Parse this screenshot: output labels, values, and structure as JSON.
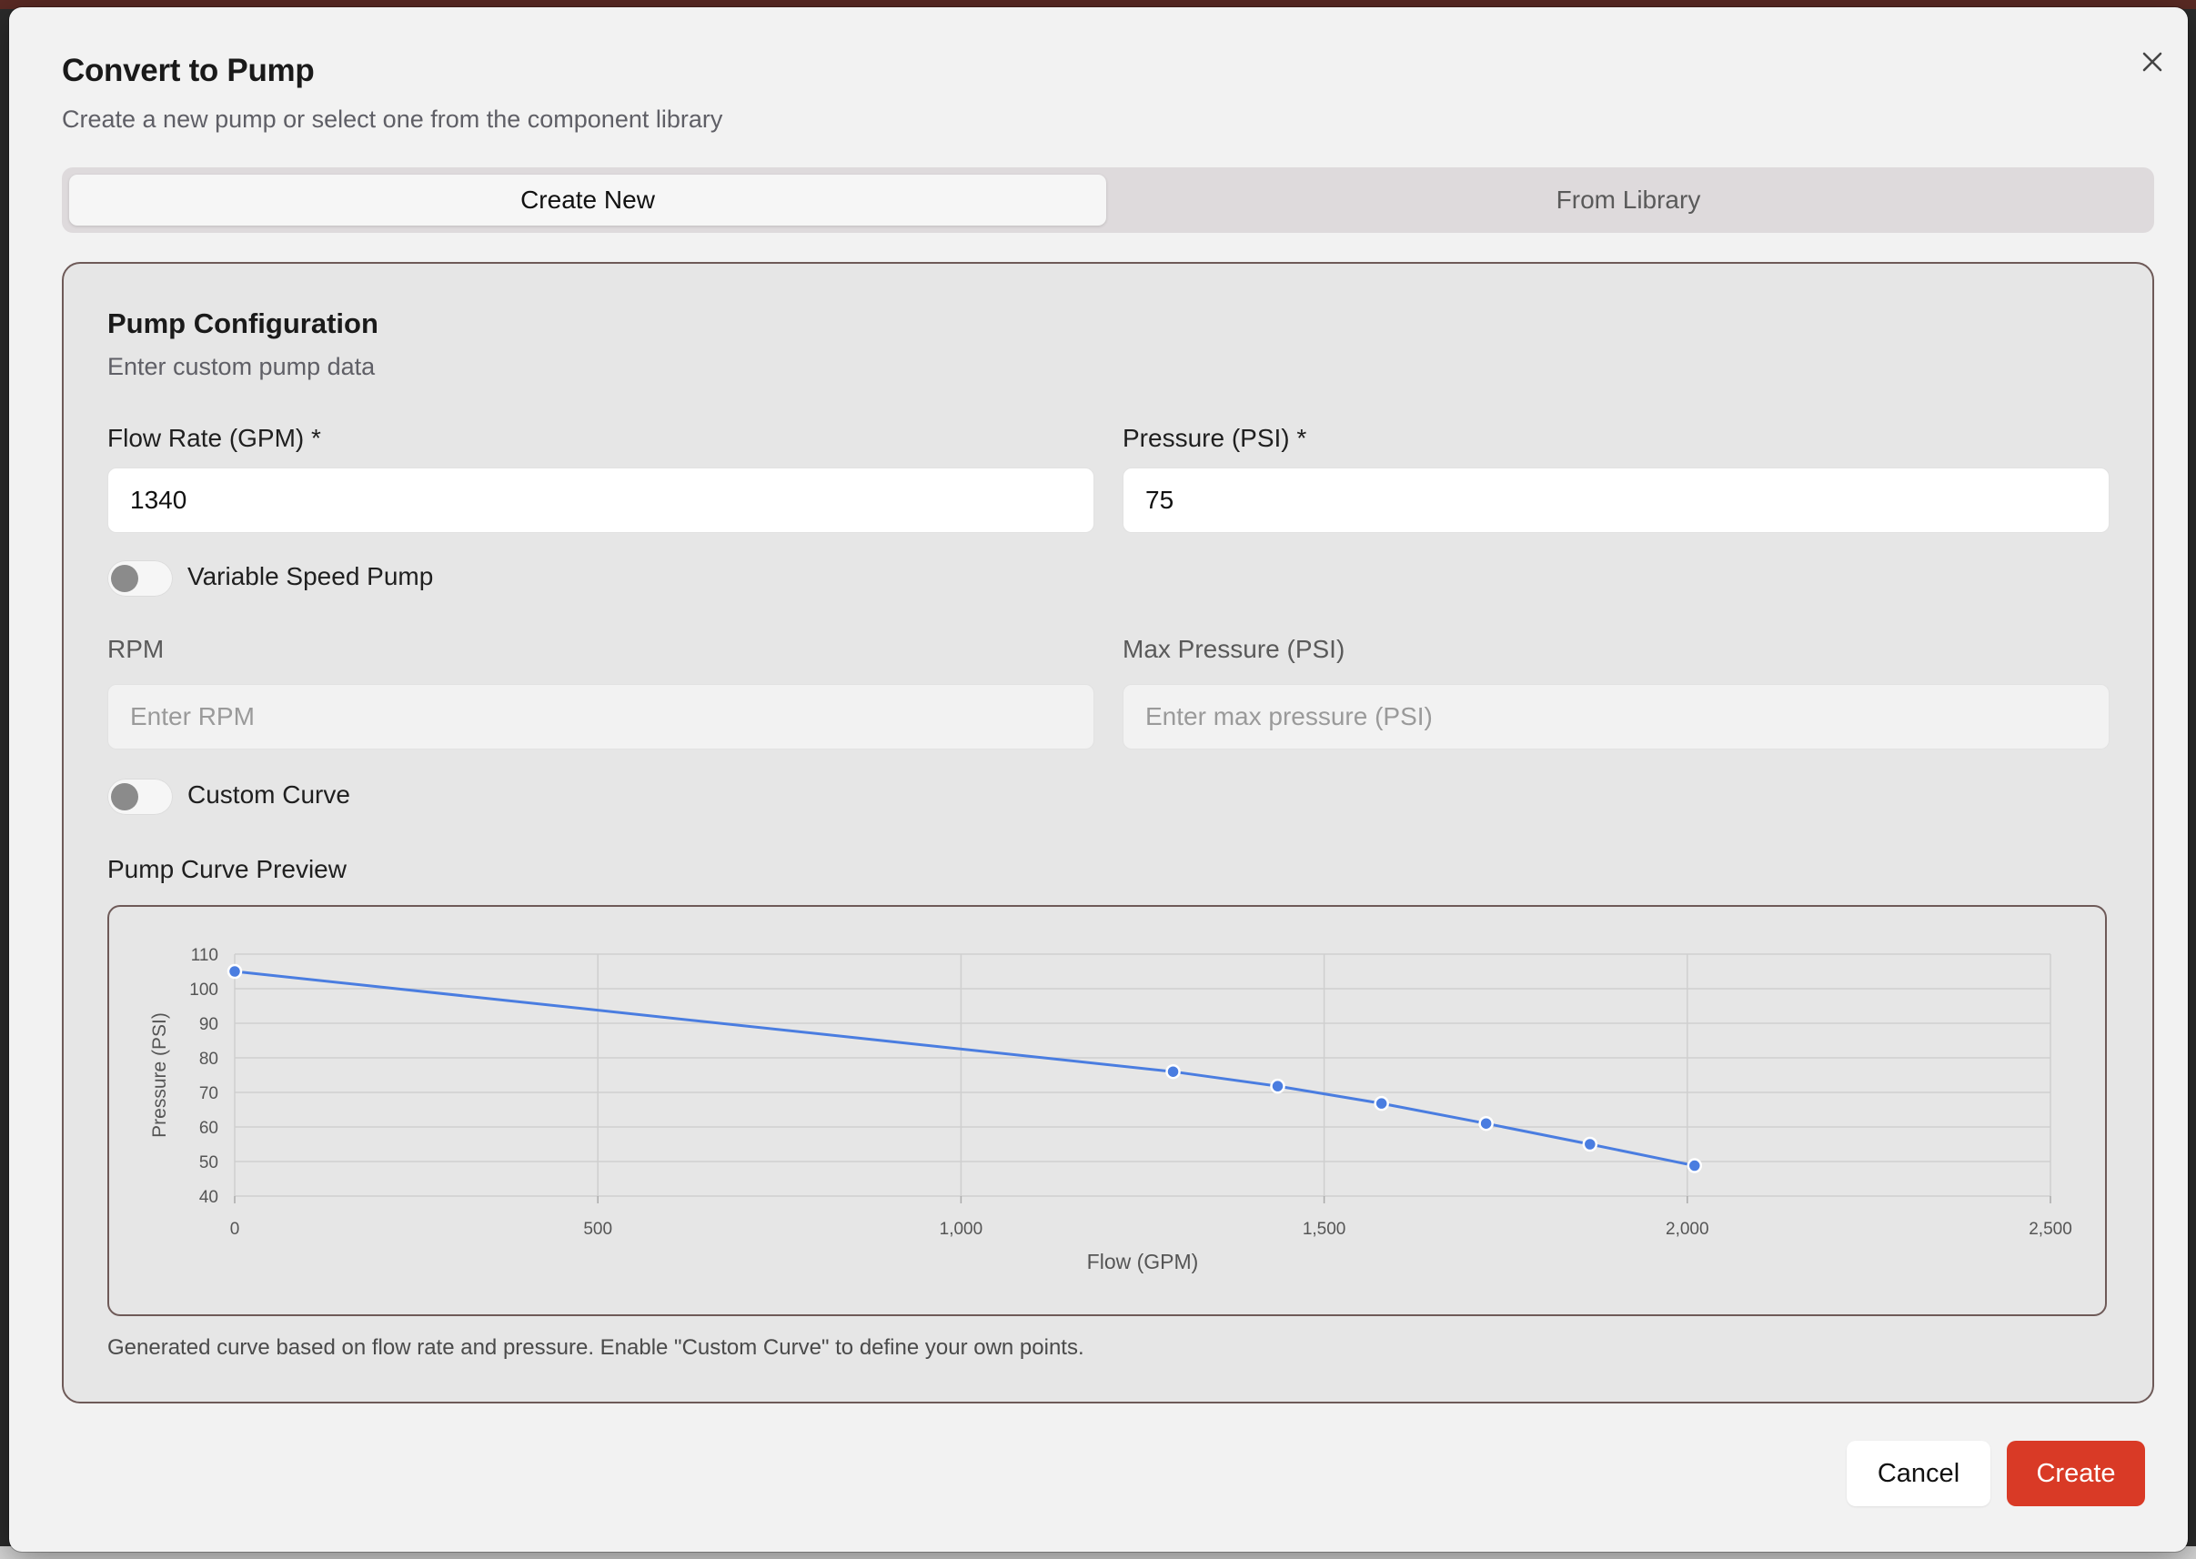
{
  "dialog": {
    "title": "Convert to Pump",
    "subtitle": "Create a new pump or select one from the component library",
    "close_icon": "close-icon"
  },
  "tabs": [
    {
      "label": "Create New",
      "active": true
    },
    {
      "label": "From Library",
      "active": false
    }
  ],
  "config": {
    "title": "Pump Configuration",
    "subtitle": "Enter custom pump data",
    "flow_label": "Flow Rate (GPM) *",
    "flow_value": "1340",
    "pressure_label": "Pressure (PSI) *",
    "pressure_value": "75",
    "variable_speed_label": "Variable Speed Pump",
    "variable_speed_on": false,
    "rpm_label": "RPM",
    "rpm_placeholder": "Enter RPM",
    "max_pressure_label": "Max Pressure (PSI)",
    "max_pressure_placeholder": "Enter max pressure (PSI)",
    "custom_curve_label": "Custom Curve",
    "custom_curve_on": false,
    "chart_heading": "Pump Curve Preview",
    "chart_note": "Generated curve based on flow rate and pressure. Enable \"Custom Curve\" to define your own points."
  },
  "chart_data": {
    "type": "line",
    "xlabel": "Flow (GPM)",
    "ylabel": "Pressure (PSI)",
    "xlim": [
      0,
      2500
    ],
    "ylim": [
      40,
      110
    ],
    "xticks": [
      0,
      500,
      1000,
      1500,
      2000,
      2500
    ],
    "xtick_labels": [
      "0",
      "500",
      "1,000",
      "1,500",
      "2,000",
      "2,500"
    ],
    "yticks": [
      40,
      50,
      60,
      70,
      80,
      90,
      100,
      110
    ],
    "grid": true,
    "color": "#4a7de0",
    "series": [
      {
        "x": [
          0,
          1292,
          1436,
          1579,
          1723,
          1866,
          2010
        ],
        "y": [
          105,
          76,
          71.8,
          66.8,
          61,
          55,
          48.8
        ]
      }
    ]
  },
  "footer": {
    "cancel_label": "Cancel",
    "create_label": "Create",
    "accent": "#d93a26"
  }
}
